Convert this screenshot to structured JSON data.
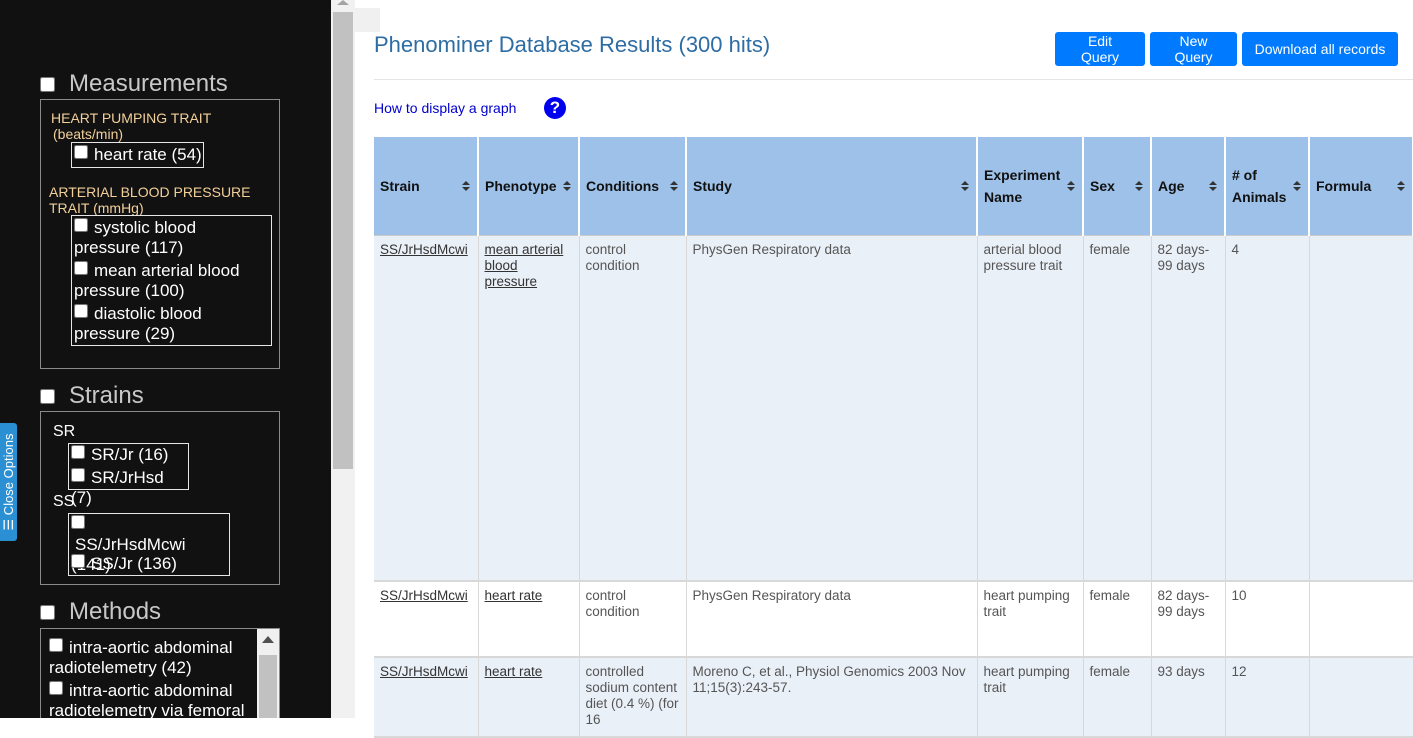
{
  "sidebar": {
    "close_options": "☰ Close Options",
    "measurements": {
      "title": "Measurements",
      "groups": [
        {
          "label": "HEART PUMPING TRAIT (beats/min)",
          "options": [
            "heart rate (54)"
          ]
        },
        {
          "label": "ARTERIAL BLOOD PRESSURE TRAIT (mmHg)",
          "options": [
            "systolic blood pressure (117)",
            "mean arterial blood pressure (100)",
            "diastolic blood pressure (29)"
          ]
        }
      ]
    },
    "strains": {
      "title": "Strains",
      "groups": [
        {
          "label": "SR",
          "options": [
            "SR/Jr (16)",
            "SR/JrHsd (7)"
          ]
        },
        {
          "label": "SS",
          "options": [
            "SS/JrHsdMcwi (141)",
            "SS/Jr (136)"
          ]
        }
      ]
    },
    "methods": {
      "title": "Methods",
      "options": [
        "intra-aortic abdominal radiotelemetry (42)",
        "intra-aortic abdominal radiotelemetry via femoral"
      ]
    }
  },
  "main": {
    "title": "Phenominer Database Results (300 hits)",
    "buttons": {
      "edit": "Edit Query",
      "new": "New Query",
      "download": "Download all records"
    },
    "graph_link": "How to display a graph",
    "help_glyph": "?",
    "table": {
      "headers": [
        "Strain",
        "Phenotype",
        "Conditions",
        "Study",
        "Experiment Name",
        "Sex",
        "Age",
        "# of Animals",
        "Formula"
      ],
      "rows": [
        {
          "strain": "SS/JrHsdMcwi",
          "phenotype": "mean arterial blood pressure",
          "conditions": "control condition",
          "study": "PhysGen Respiratory data",
          "experiment": "arterial blood pressure trait",
          "sex": "female",
          "age": "82 days-99 days",
          "animals": "4",
          "formula": ""
        },
        {
          "strain": "SS/JrHsdMcwi",
          "phenotype": "heart rate",
          "conditions": "control condition",
          "study": "PhysGen Respiratory data",
          "experiment": "heart pumping trait",
          "sex": "female",
          "age": "82 days-99 days",
          "animals": "10",
          "formula": ""
        },
        {
          "strain": "SS/JrHsdMcwi",
          "phenotype": "heart rate",
          "conditions": "controlled sodium content diet (0.4 %) (for 16",
          "study": "Moreno C, et al., Physiol Genomics 2003 Nov 11;15(3):243-57.",
          "experiment": "heart pumping trait",
          "sex": "female",
          "age": "93 days",
          "animals": "12",
          "formula": ""
        }
      ]
    }
  }
}
